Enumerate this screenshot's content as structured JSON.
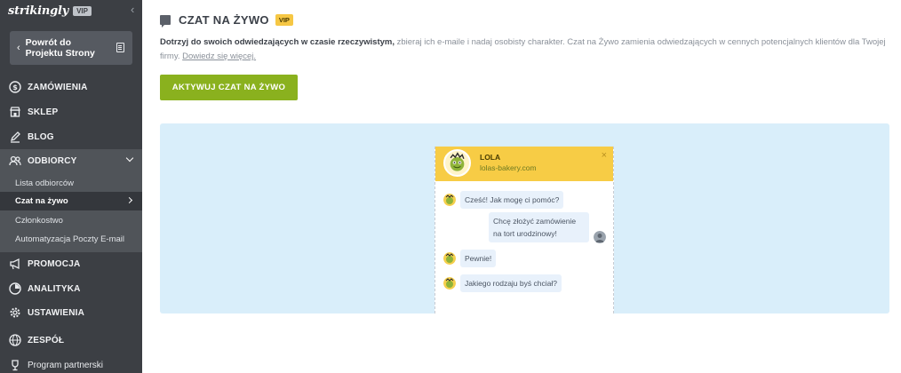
{
  "sidebar": {
    "brand": "strikingly",
    "brand_badge": "VIP",
    "back_button": "Powrót do Projektu Strony",
    "items": {
      "orders": "ZAMÓWIENIA",
      "shop": "SKLEP",
      "blog": "BLOG",
      "audience": "ODBIORCY",
      "promo": "PROMOCJA",
      "analytics": "ANALITYKA",
      "settings": "USTAWIENIA",
      "team": "ZESPÓŁ",
      "partner": "Program partnerski"
    },
    "sub_items": {
      "list": "Lista odbiorców",
      "live_chat": "Czat na żywo",
      "membership": "Członkostwo",
      "automation": "Automatyzacja Poczty E-mail"
    }
  },
  "main": {
    "title": "CZAT NA ŻYWO",
    "title_badge": "VIP",
    "desc_bold": "Dotrzyj do swoich odwiedzających w czasie rzeczywistym,",
    "desc_rest": " zbieraj ich e-maile i nadaj osobisty charakter. Czat na Żywo zamienia odwiedzających w cennych potencjalnych klientów dla Twojej firmy. ",
    "learn_more": "Dowiedz się więcej.",
    "activate_button": "AKTYWUJ CZAT NA ŻYWO"
  },
  "chat_preview": {
    "agent_name": "LOLA",
    "agent_site": "lolas-bakery.com",
    "messages": [
      {
        "from": "agent",
        "text": "Cześć! Jak mogę ci pomóc?"
      },
      {
        "from": "visitor",
        "text": "Chcę złożyć zamówienie na tort urodzinowy!"
      },
      {
        "from": "agent",
        "text": "Pewnie!"
      },
      {
        "from": "agent",
        "text": "Jakiego rodzaju byś chciał?"
      }
    ]
  },
  "colors": {
    "sidebar": "#3c3f44",
    "accent_green": "#8ab11e",
    "chat_header": "#f7cc45",
    "preview_bg": "#d9eefa"
  }
}
